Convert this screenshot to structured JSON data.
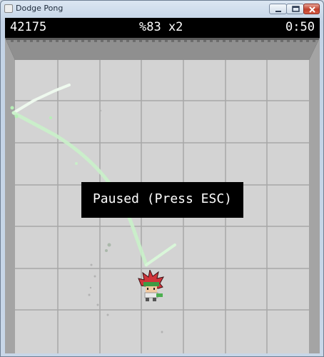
{
  "window": {
    "title": "Dodge Pong"
  },
  "hud": {
    "score": "42175",
    "multiplier": "%83 x2",
    "timer": "0:50"
  },
  "overlay": {
    "pause_text": "Paused (Press ESC)"
  },
  "colors": {
    "floor": "#d3d3d3",
    "grid_lines": "#a8a8a8",
    "walls": "#a4a4a4",
    "ball_trail": "#b6f0b6",
    "hud_bg": "#000000",
    "hud_text": "#ffffff"
  },
  "icons": [
    "app-icon",
    "minimize-icon",
    "maximize-icon",
    "close-icon"
  ]
}
